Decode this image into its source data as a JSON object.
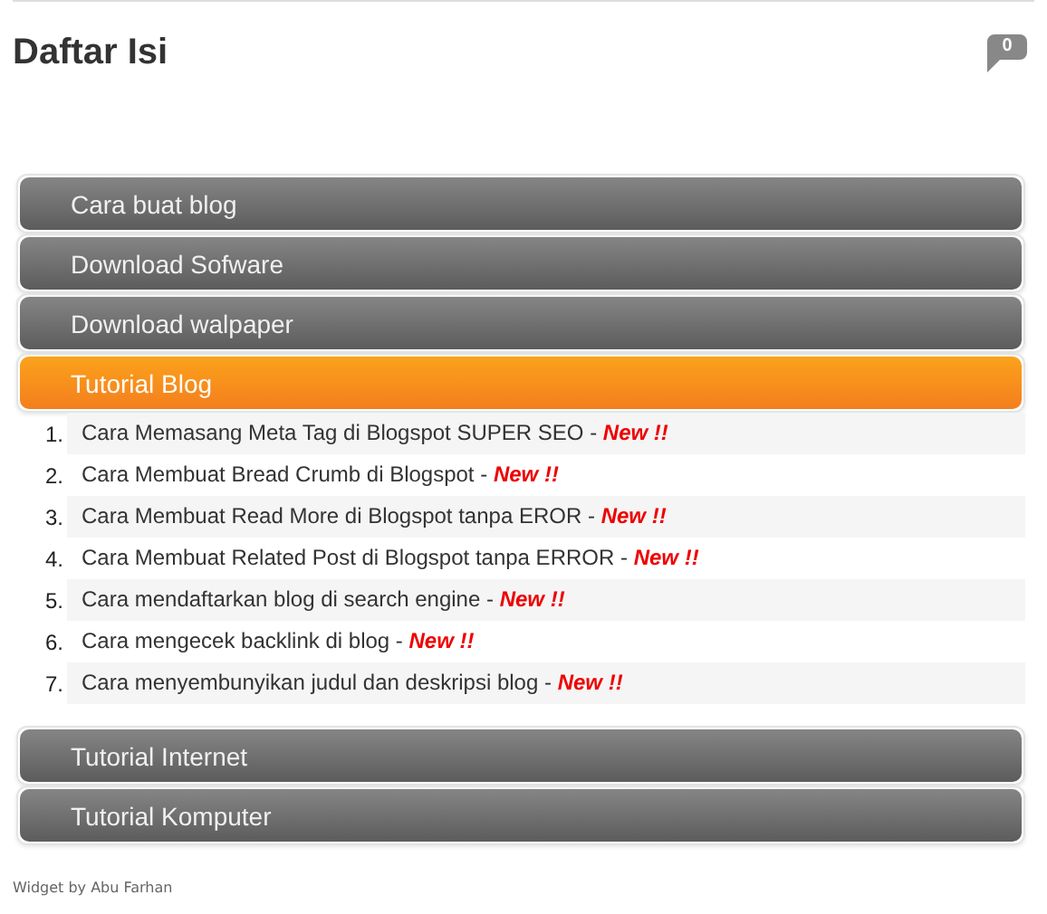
{
  "title": "Daftar Isi",
  "comment_count": "0",
  "sections": [
    {
      "label": "Cara buat blog",
      "expanded": false
    },
    {
      "label": "Download Sofware",
      "expanded": false
    },
    {
      "label": "Download walpaper",
      "expanded": false
    },
    {
      "label": "Tutorial Blog",
      "expanded": true,
      "items": [
        {
          "number": "1.",
          "text": "Cara Memasang Meta Tag di Blogspot SUPER SEO -",
          "badge": "New !!"
        },
        {
          "number": "2.",
          "text": "Cara Membuat Bread Crumb di Blogspot -",
          "badge": "New !!"
        },
        {
          "number": "3.",
          "text": "Cara Membuat Read More di Blogspot tanpa EROR -",
          "badge": "New !!"
        },
        {
          "number": "4.",
          "text": "Cara Membuat Related Post di Blogspot tanpa ERROR -",
          "badge": "New !!"
        },
        {
          "number": "5.",
          "text": "Cara mendaftarkan blog di search engine -",
          "badge": "New !!"
        },
        {
          "number": "6.",
          "text": "Cara mengecek backlink di blog -",
          "badge": "New !!"
        },
        {
          "number": "7.",
          "text": "Cara menyembunyikan judul dan deskripsi blog -",
          "badge": "New !!"
        }
      ]
    },
    {
      "label": "Tutorial Internet",
      "expanded": false
    },
    {
      "label": "Tutorial Komputer",
      "expanded": false
    }
  ],
  "footer": "Widget by Abu Farhan"
}
